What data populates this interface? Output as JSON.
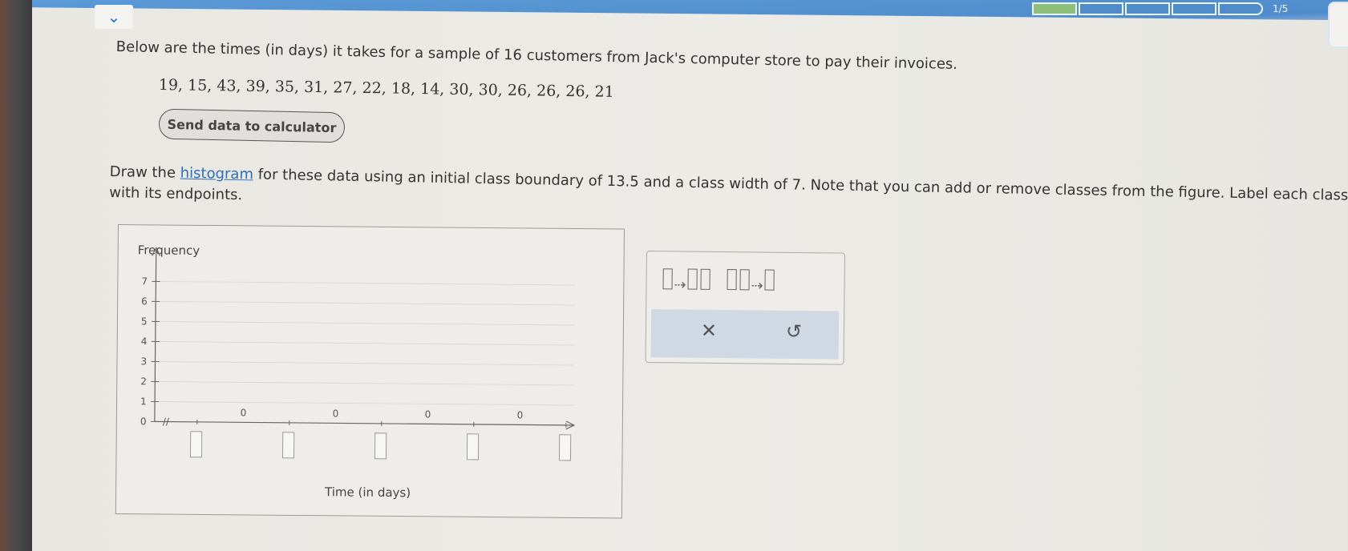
{
  "header": {
    "progress": {
      "completed": 1,
      "total": 5,
      "label": "1/5"
    }
  },
  "question": {
    "intro": "Below are the times (in days) it takes for a sample of 16 customers from Jack's computer store to pay their invoices.",
    "data_values": "19, 15, 43, 39, 35, 31, 27, 22, 18, 14, 30, 30, 26, 26, 26, 21",
    "send_button": "Send data to calculator",
    "instruction_pre": "Draw the ",
    "instruction_link": "histogram",
    "instruction_post": " for these data using an initial class boundary of 13.5 and a class width of 7. Note that you can add or remove classes from the figure. Label each class with its endpoints."
  },
  "graph": {
    "y_label": "Frequency",
    "x_label": "Time (in days)",
    "y_ticks": [
      "0",
      "1",
      "2",
      "3",
      "4",
      "5",
      "6",
      "7"
    ],
    "bar_values": [
      "0",
      "0",
      "0",
      "0"
    ]
  },
  "chart_data": {
    "type": "bar",
    "title": "",
    "xlabel": "Time (in days)",
    "ylabel": "Frequency",
    "ylim": [
      0,
      7
    ],
    "categories": [
      "",
      "",
      "",
      ""
    ],
    "values": [
      0,
      0,
      0,
      0
    ],
    "grid": true
  },
  "tools": {
    "add_class_icon": "add-class-icon",
    "remove_class_icon": "remove-class-icon",
    "clear_icon": "close-icon",
    "undo_icon": "undo-icon",
    "clear_glyph": "✕",
    "undo_glyph": "↺"
  }
}
